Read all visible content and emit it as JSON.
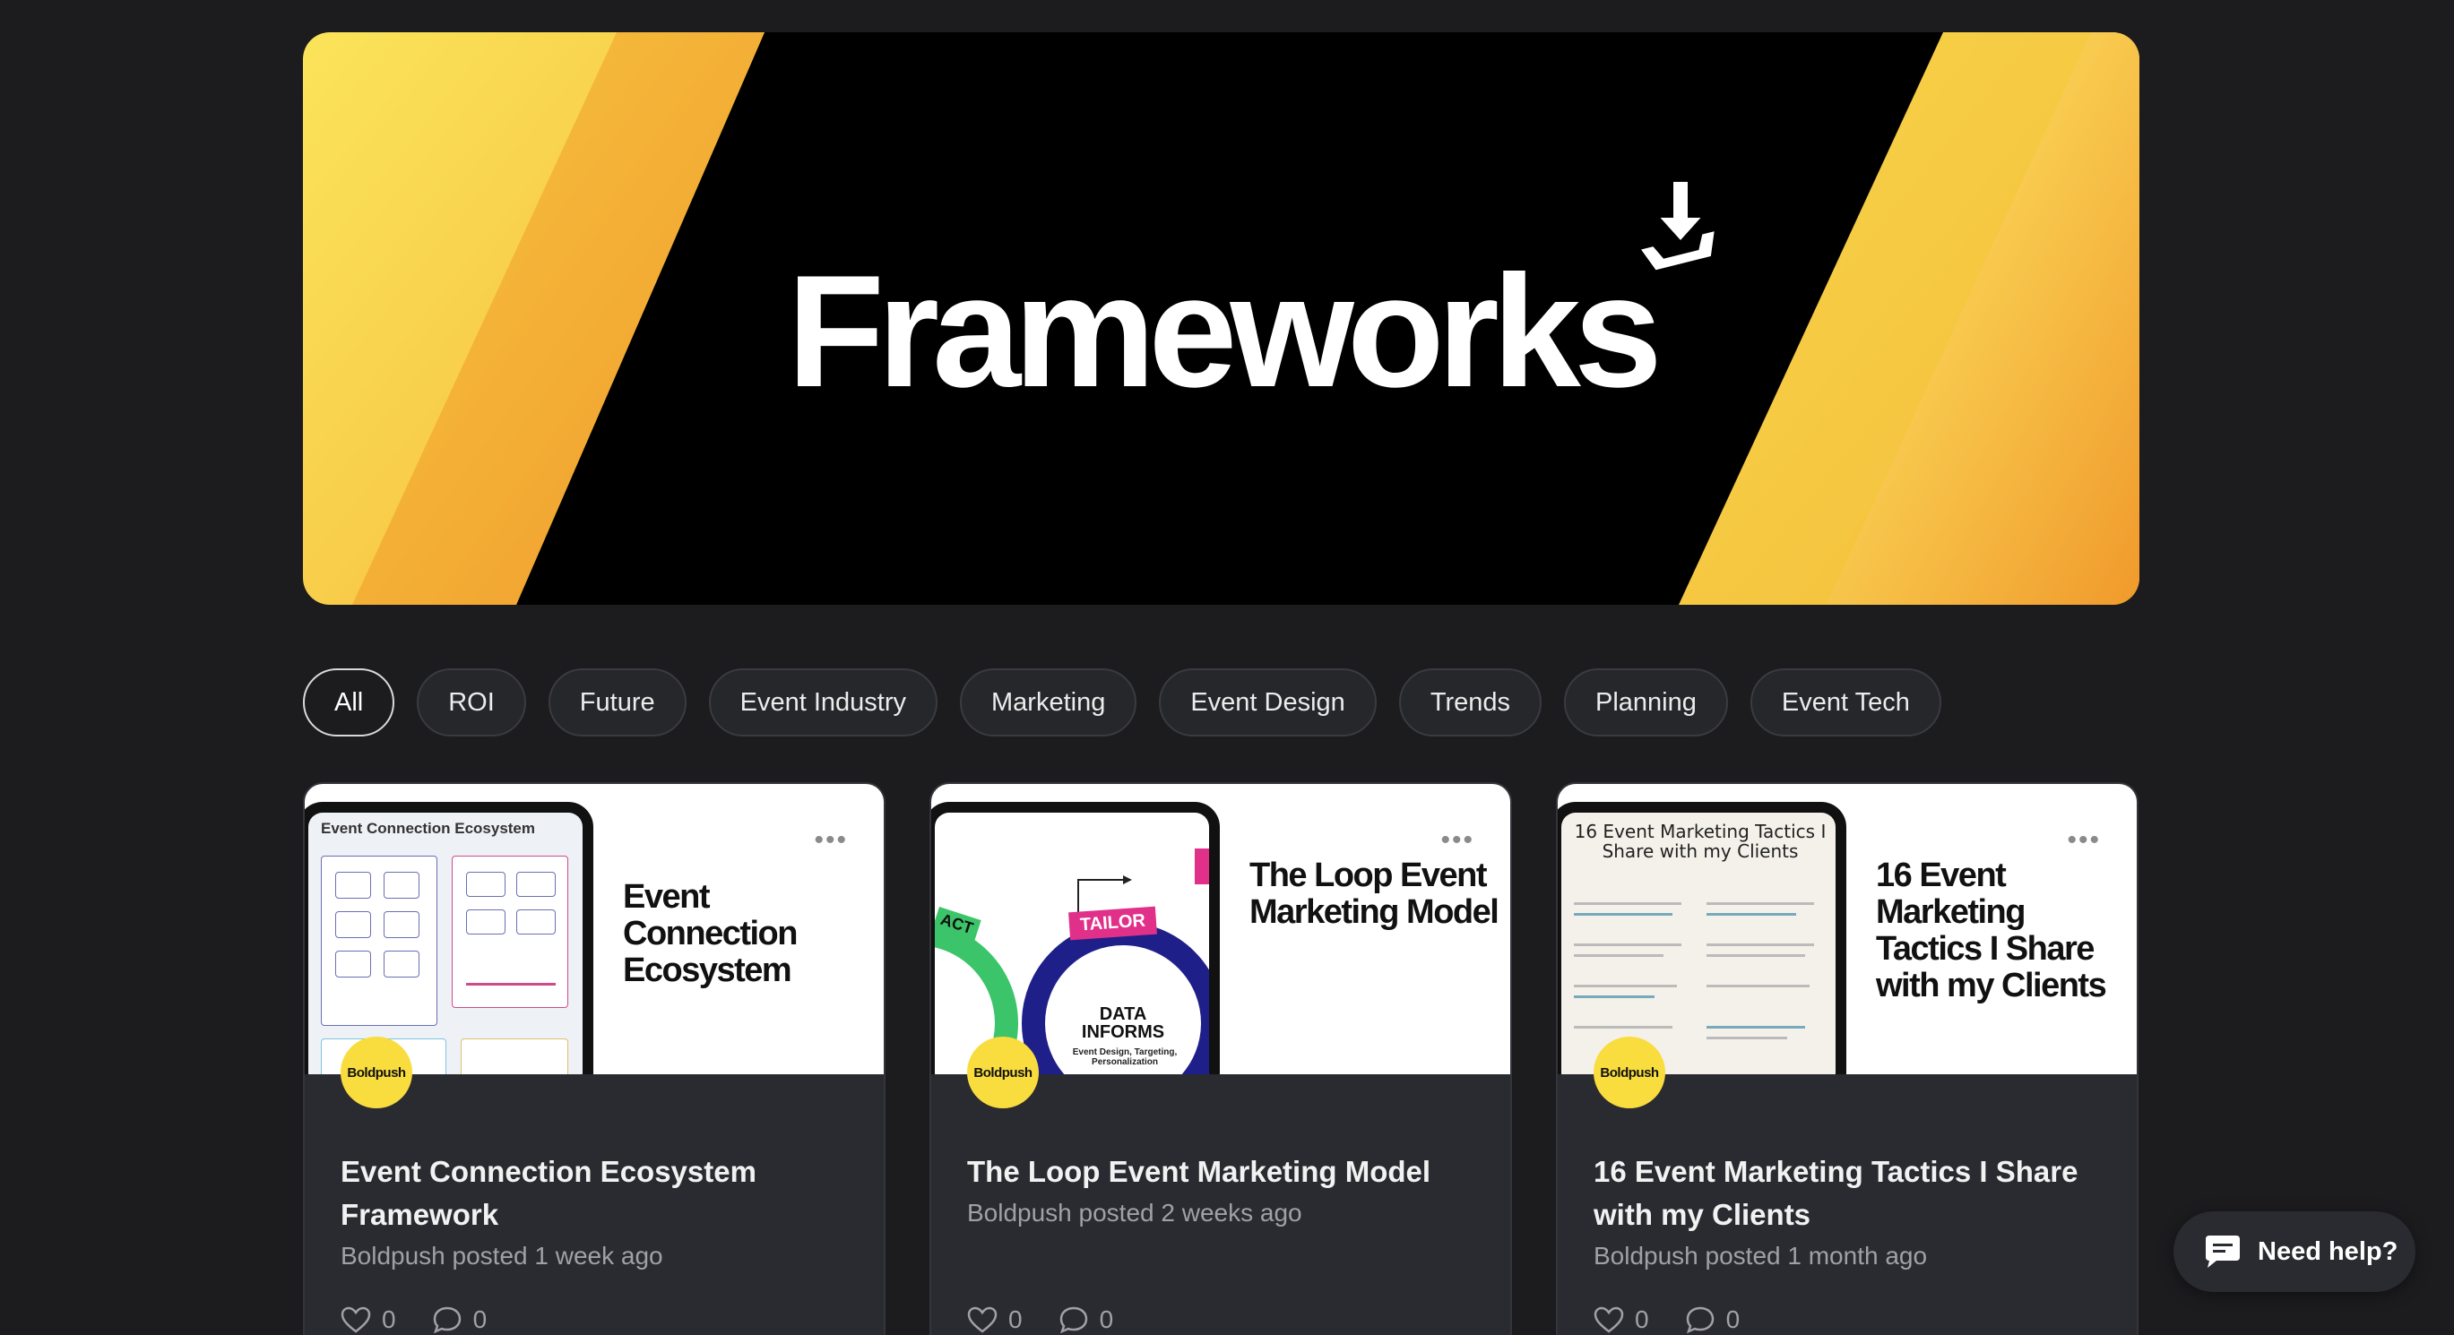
{
  "hero": {
    "title": "Frameworks",
    "colors": {
      "yellow": "#f9dc3d",
      "orange": "#f0a030"
    }
  },
  "filters": [
    {
      "label": "All",
      "active": true
    },
    {
      "label": "ROI",
      "active": false
    },
    {
      "label": "Future",
      "active": false
    },
    {
      "label": "Event Industry",
      "active": false
    },
    {
      "label": "Marketing",
      "active": false
    },
    {
      "label": "Event Design",
      "active": false
    },
    {
      "label": "Trends",
      "active": false
    },
    {
      "label": "Planning",
      "active": false
    },
    {
      "label": "Event Tech",
      "active": false
    }
  ],
  "cards": [
    {
      "thumb_title": "Event Connection Ecosystem",
      "screen_title": "Event Connection Ecosystem",
      "avatar": "Boldpush",
      "title": "Event Connection Ecosystem Framework",
      "meta": "Boldpush posted 1 week ago",
      "likes": "0",
      "comments": "0"
    },
    {
      "thumb_title": "The Loop Event Marketing Model",
      "screen_labels": {
        "tailor": "TAILOR",
        "data": "DATA INFORMS",
        "sub": "Event Design, Targeting, Personalization",
        "left": "ACT"
      },
      "avatar": "Boldpush",
      "title": "The Loop Event Marketing Model",
      "meta": "Boldpush posted 2 weeks ago",
      "likes": "0",
      "comments": "0"
    },
    {
      "thumb_title": "16 Event Marketing Tactics I Share with my Clients",
      "screen_title": "16 Event Marketing Tactics I Share with my Clients",
      "avatar": "Boldpush",
      "title": "16 Event Marketing Tactics I Share with my Clients",
      "meta": "Boldpush posted 1 month ago",
      "likes": "0",
      "comments": "0"
    }
  ],
  "help": {
    "label": "Need help?"
  }
}
